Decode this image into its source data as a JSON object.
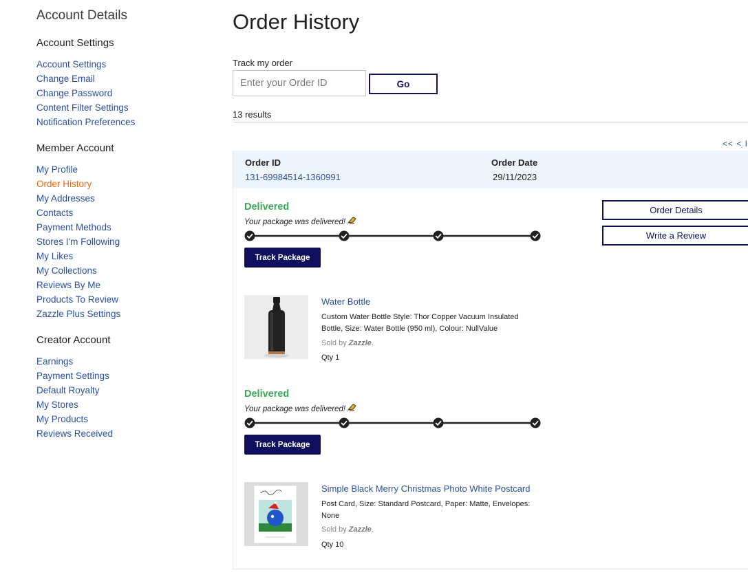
{
  "sidebar": {
    "title": "Account Details",
    "sections": [
      {
        "heading": "Account Settings",
        "items": [
          "Account Settings",
          "Change Email",
          "Change Password",
          "Content Filter Settings",
          "Notification Preferences"
        ]
      },
      {
        "heading": "Member Account",
        "items": [
          "My Profile",
          "Order History",
          "My Addresses",
          "Contacts",
          "Payment Methods",
          "Stores I'm Following",
          "My Likes",
          "My Collections",
          "Reviews By Me",
          "Products To Review",
          "Zazzle Plus Settings"
        ]
      },
      {
        "heading": "Creator Account",
        "items": [
          "Earnings",
          "Payment Settings",
          "Default Royalty",
          "My Stores",
          "My Products",
          "Reviews Received"
        ]
      }
    ],
    "active_item": "Order History"
  },
  "main": {
    "title": "Order History",
    "track_label": "Track my order",
    "track_placeholder": "Enter your Order ID",
    "go_label": "Go",
    "results": "13 results",
    "pager": "<< < I"
  },
  "order": {
    "id_label": "Order ID",
    "id": "131-69984514-1360991",
    "date_label": "Order Date",
    "date": "29/11/2023",
    "details_button": "Order Details",
    "review_button": "Write a Review",
    "shipments": [
      {
        "status": "Delivered",
        "message": "Your package was delivered!",
        "steps_completed": 4,
        "steps_total": 4,
        "track_button": "Track Package",
        "product": {
          "name": "Water Bottle",
          "description": "Custom Water Bottle Style: Thor Copper Vacuum Insulated Bottle, Size: Water Bottle (950 ml), Colour: NullValue",
          "sold_by_prefix": "Sold by",
          "seller": "Zazzle",
          "qty": "Qty 1",
          "thumb_icon": "water-bottle-image"
        }
      },
      {
        "status": "Delivered",
        "message": "Your package was delivered!",
        "steps_completed": 4,
        "steps_total": 4,
        "track_button": "Track Package",
        "product": {
          "name": "Simple Black Merry Christmas Photo White Postcard",
          "description": "Post Card, Size: Standard Postcard, Paper: Matte, Envelopes: None",
          "sold_by_prefix": "Sold by",
          "seller": "Zazzle",
          "qty": "Qty 10",
          "thumb_icon": "postcard-image"
        }
      }
    ]
  },
  "colors": {
    "link": "#2a4f9e",
    "active": "#e36a12",
    "delivered": "#3ea85a",
    "primary_button": "#0f0f5e",
    "header_band": "#eef5fc"
  }
}
